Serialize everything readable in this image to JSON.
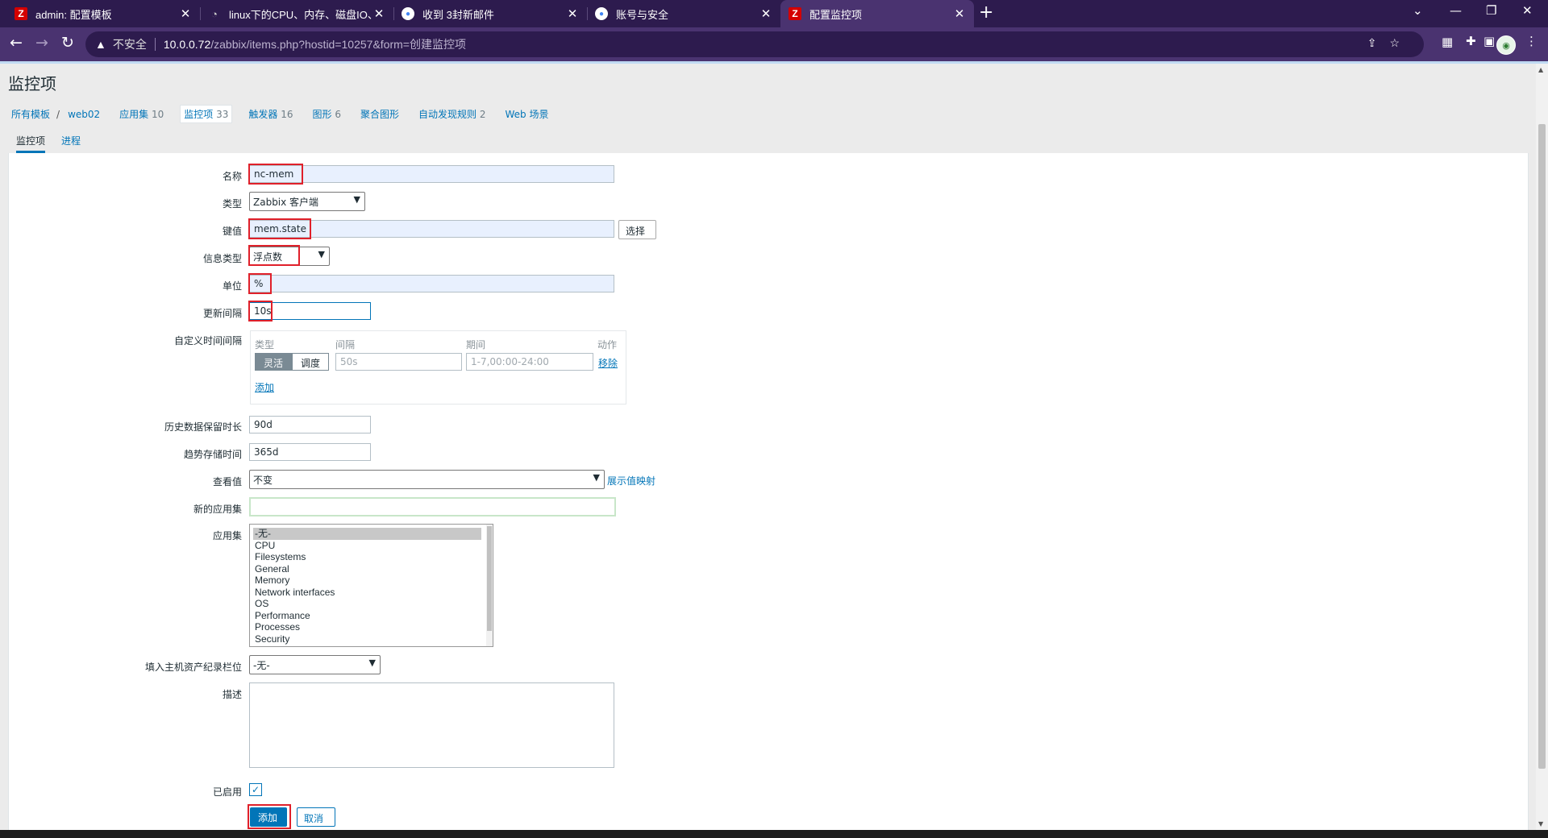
{
  "browser": {
    "tabs": [
      {
        "title": "admin: 配置模板",
        "icon": "zabbix-icon"
      },
      {
        "title": "linux下的CPU、内存、磁盘IO、",
        "icon": "github-icon"
      },
      {
        "title": "收到 3封新邮件",
        "icon": "chrome-icon"
      },
      {
        "title": "账号与安全",
        "icon": "chrome-icon"
      },
      {
        "title": "配置监控项",
        "icon": "zabbix-icon"
      }
    ],
    "not_secure": "不安全",
    "url_host": "10.0.0.72",
    "url_path": "/zabbix/items.php?hostid=10257&form=创建监控项"
  },
  "page": {
    "title": "监控项",
    "breadcrumb": {
      "all_templates": "所有模板",
      "host": "web02",
      "apps": "应用集",
      "apps_count": "10",
      "items": "监控项",
      "items_count": "33",
      "triggers": "触发器",
      "triggers_count": "16",
      "graphs": "图形",
      "graphs_count": "6",
      "screens": "聚合图形",
      "discovery": "自动发现规则",
      "discovery_count": "2",
      "web": "Web 场景"
    },
    "tabs": {
      "item": "监控项",
      "process": "进程"
    }
  },
  "form": {
    "name_label": "名称",
    "name_value": "nc-mem",
    "type_label": "类型",
    "type_value": "Zabbix 客户端",
    "key_label": "键值",
    "key_value": "mem.state",
    "select_button": "选择",
    "info_type_label": "信息类型",
    "info_type_value": "浮点数",
    "units_label": "单位",
    "units_value": "%",
    "interval_label": "更新间隔",
    "interval_value": "10s",
    "custom_label": "自定义时间间隔",
    "custom": {
      "col_type": "类型",
      "col_interval": "间隔",
      "col_period": "期间",
      "col_action": "动作",
      "flexible": "灵活",
      "scheduling": "调度",
      "interval_placeholder": "50s",
      "period_placeholder": "1-7,00:00-24:00",
      "remove": "移除",
      "add": "添加"
    },
    "history_label": "历史数据保留时长",
    "history_value": "90d",
    "trends_label": "趋势存储时间",
    "trends_value": "365d",
    "valuemap_label": "查看值",
    "valuemap_value": "不变",
    "valuemap_link": "展示值映射",
    "new_app_label": "新的应用集",
    "new_app_value": "",
    "apps_label": "应用集",
    "apps": [
      "-无-",
      "CPU",
      "Filesystems",
      "General",
      "Memory",
      "Network interfaces",
      "OS",
      "Performance",
      "Processes",
      "Security"
    ],
    "inventory_label": "填入主机资产纪录栏位",
    "inventory_value": "-无-",
    "desc_label": "描述",
    "enabled_label": "已启用",
    "add_button": "添加",
    "cancel_button": "取消"
  }
}
